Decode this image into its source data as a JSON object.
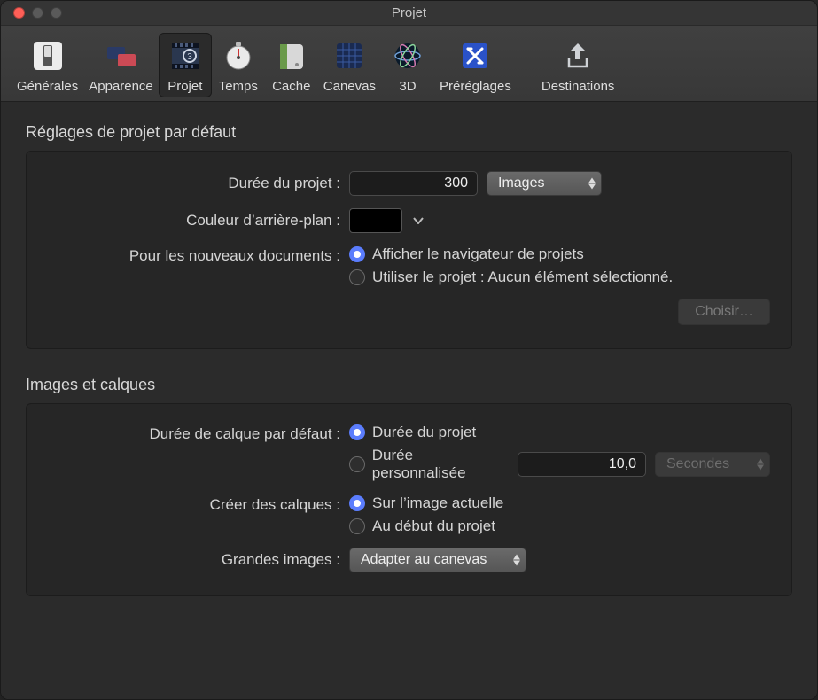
{
  "window": {
    "title": "Projet"
  },
  "toolbar": {
    "items": [
      {
        "id": "generales",
        "label": "Générales"
      },
      {
        "id": "apparence",
        "label": "Apparence"
      },
      {
        "id": "projet",
        "label": "Projet"
      },
      {
        "id": "temps",
        "label": "Temps"
      },
      {
        "id": "cache",
        "label": "Cache"
      },
      {
        "id": "canevas",
        "label": "Canevas"
      },
      {
        "id": "3d",
        "label": "3D"
      },
      {
        "id": "prereglages",
        "label": "Préréglages"
      },
      {
        "id": "destinations",
        "label": "Destinations"
      }
    ],
    "active": "projet"
  },
  "section1": {
    "title": "Réglages de projet par défaut",
    "projectDuration": {
      "label": "Durée du projet :",
      "value": "300",
      "unit": "Images"
    },
    "bgColor": {
      "label": "Couleur d’arrière-plan :",
      "hex": "#000000"
    },
    "newDocs": {
      "label": "Pour les nouveaux documents :",
      "opt1": "Afficher le navigateur de projets",
      "opt2": "Utiliser le projet : Aucun élément sélectionné.",
      "choose": "Choisir…"
    }
  },
  "section2": {
    "title": "Images et calques",
    "layerDuration": {
      "label": "Durée de calque par défaut :",
      "opt1": "Durée du projet",
      "opt2": "Durée personnalisée",
      "customValue": "10,0",
      "customUnit": "Secondes"
    },
    "createLayers": {
      "label": "Créer des calques :",
      "opt1": "Sur l’image actuelle",
      "opt2": "Au début du projet"
    },
    "largeImages": {
      "label": "Grandes images :",
      "value": "Adapter au canevas"
    }
  }
}
